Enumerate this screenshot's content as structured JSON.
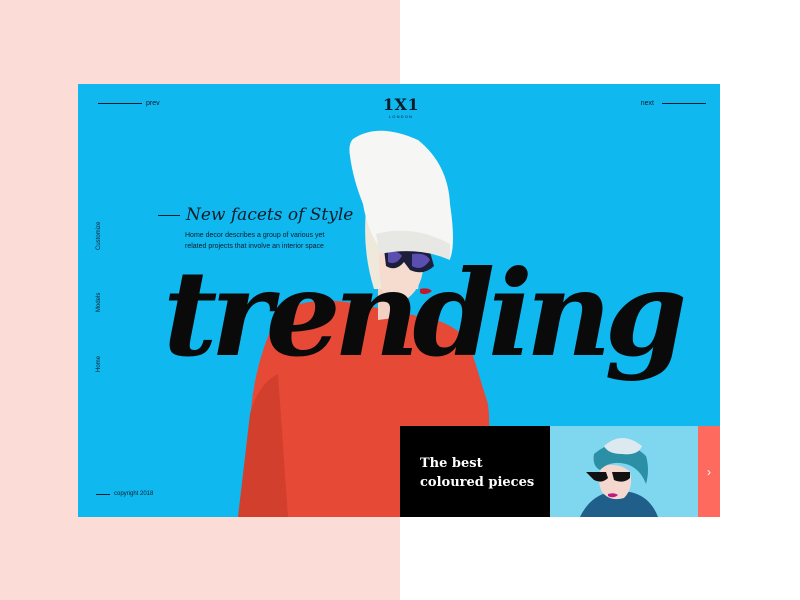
{
  "header": {
    "prev_label": "prev",
    "next_label": "next",
    "logo_mark": "1X1",
    "logo_sub": "LONDON"
  },
  "side_nav": {
    "items": [
      {
        "label": "Customize"
      },
      {
        "label": "Models"
      },
      {
        "label": "Home"
      }
    ]
  },
  "hero": {
    "title": "New facets of Style",
    "description": "Home decor describes a group of various yet related projects that involve an interior space",
    "big_word": "trending"
  },
  "footer": {
    "copyright": "copyright 2018"
  },
  "promo": {
    "text": "The best coloured pieces",
    "next_icon": "chevron-right-icon"
  },
  "colors": {
    "card_bg": "#10b8f0",
    "page_left": "#fbdcd6",
    "accent": "#fe6a5e",
    "sweater": "#e64a36"
  }
}
